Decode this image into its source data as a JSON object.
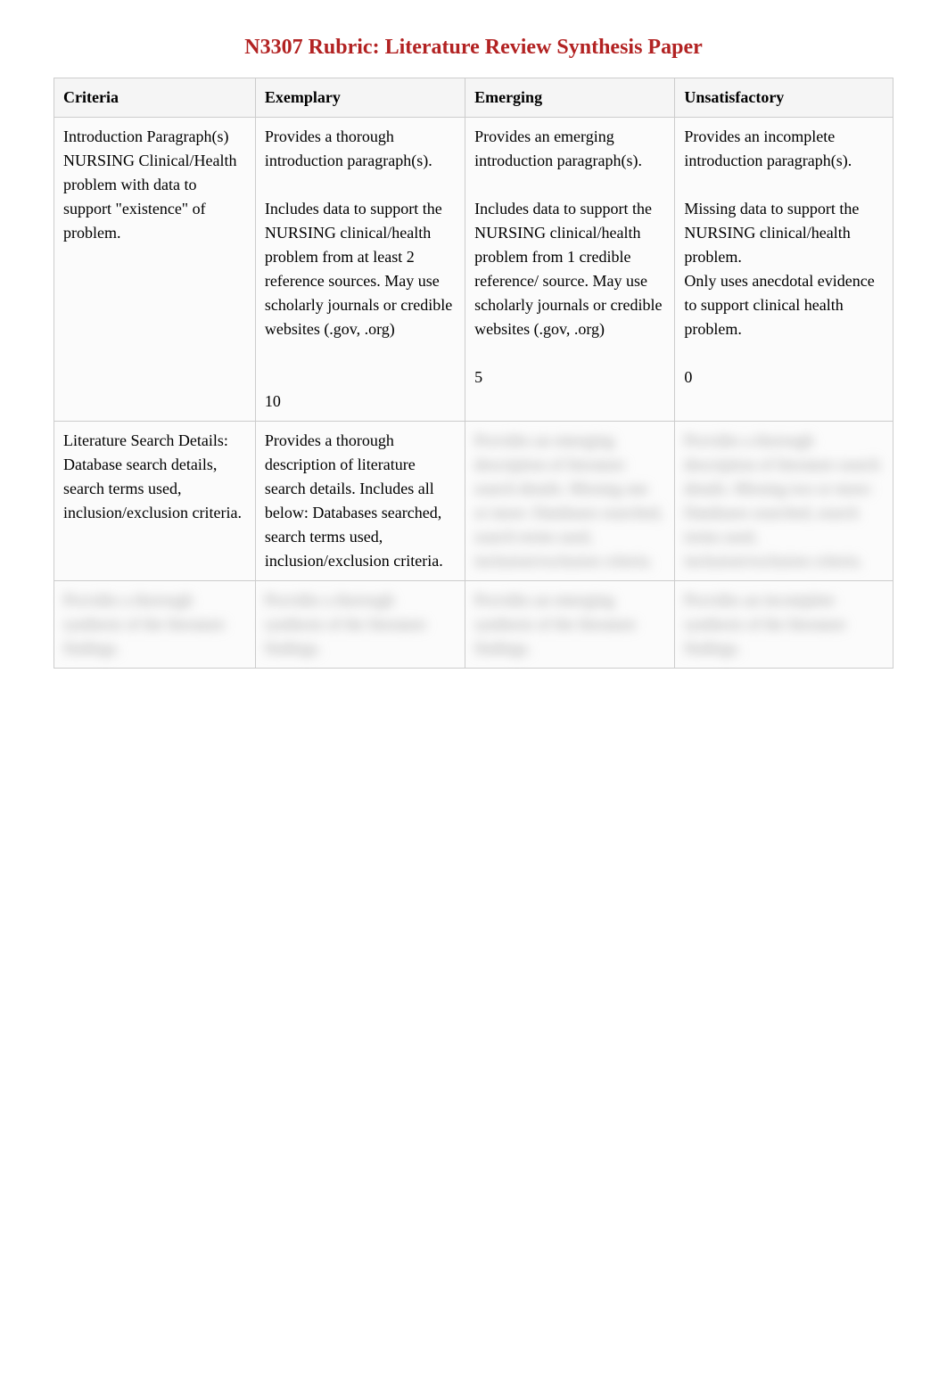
{
  "title": "N3307 Rubric: Literature Review Synthesis Paper",
  "headers": {
    "criteria": "Criteria",
    "exemplary": "Exemplary",
    "emerging": "Emerging",
    "unsatisfactory": "Unsatisfactory"
  },
  "rows": [
    {
      "criteria": "Introduction Paragraph(s) NURSING Clinical/Health problem with data to support \"existence\" of problem.",
      "exemplary": "Provides a thorough introduction paragraph(s).\n\nIncludes data to support the NURSING clinical/health problem from at least 2 reference sources. May use scholarly journals or credible websites (.gov, .org)\n\n\n10",
      "emerging": "Provides an emerging introduction paragraph(s).\n\nIncludes data to support the NURSING clinical/health problem from 1 credible reference/ source. May use scholarly journals or credible websites (.gov, .org)\n\n5",
      "unsatisfactory": "Provides an incomplete introduction paragraph(s).\n\nMissing data to support the NURSING clinical/health problem.\nOnly uses anecdotal evidence to support clinical health problem.\n\n0"
    },
    {
      "criteria": "Literature Search Details: Database search details, search terms used, inclusion/exclusion criteria.",
      "exemplary": "Provides a thorough description of literature search details. Includes all below: Databases searched, search terms used, inclusion/exclusion criteria.",
      "emerging_blurred": "Provides an emerging description of literature search details. Missing one or more: Databases searched, search terms used, inclusion/exclusion criteria.",
      "unsatisfactory_blurred": "Provides a thorough description of literature search details. Missing two or more: Databases searched, search terms used, inclusion/exclusion criteria."
    },
    {
      "criteria_blurred": "Provides a thorough synthesis of the literature findings.",
      "exemplary_blurred": "Provides a thorough synthesis of the literature findings.",
      "emerging_blurred": "Provides an emerging synthesis of the literature findings.",
      "unsatisfactory_blurred": "Provides an incomplete synthesis of the literature findings."
    }
  ]
}
